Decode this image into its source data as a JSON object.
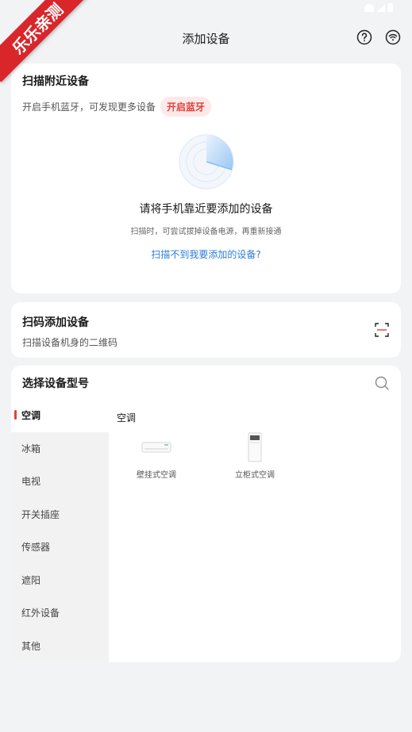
{
  "watermark": "乐乐亲测",
  "header": {
    "title": "添加设备",
    "help_icon": "question-circle-icon",
    "wifi_icon": "wifi-circle-icon"
  },
  "scan": {
    "title": "扫描附近设备",
    "bluetooth_hint": "开启手机蓝牙，可发现更多设备",
    "bluetooth_button": "开启蓝牙",
    "main_text": "请将手机靠近要添加的设备",
    "sub_text": "扫描时，可尝试拔掉设备电源，再重新接通",
    "help_link": "扫描不到我要添加的设备?"
  },
  "qr": {
    "title": "扫码添加设备",
    "subtitle": "扫描设备机身的二维码",
    "icon": "scan-code-icon"
  },
  "types": {
    "title": "选择设备型号",
    "search_icon": "search-icon",
    "categories": [
      "空调",
      "冰箱",
      "电视",
      "开关插座",
      "传感器",
      "遮阳",
      "红外设备",
      "其他"
    ],
    "selected_heading": "空调",
    "devices": [
      {
        "label": "壁挂式空调"
      },
      {
        "label": "立柜式空调"
      }
    ]
  },
  "colors": {
    "accent": "#e2403a",
    "link": "#2c7dd8",
    "background": "#f2f3f5"
  }
}
